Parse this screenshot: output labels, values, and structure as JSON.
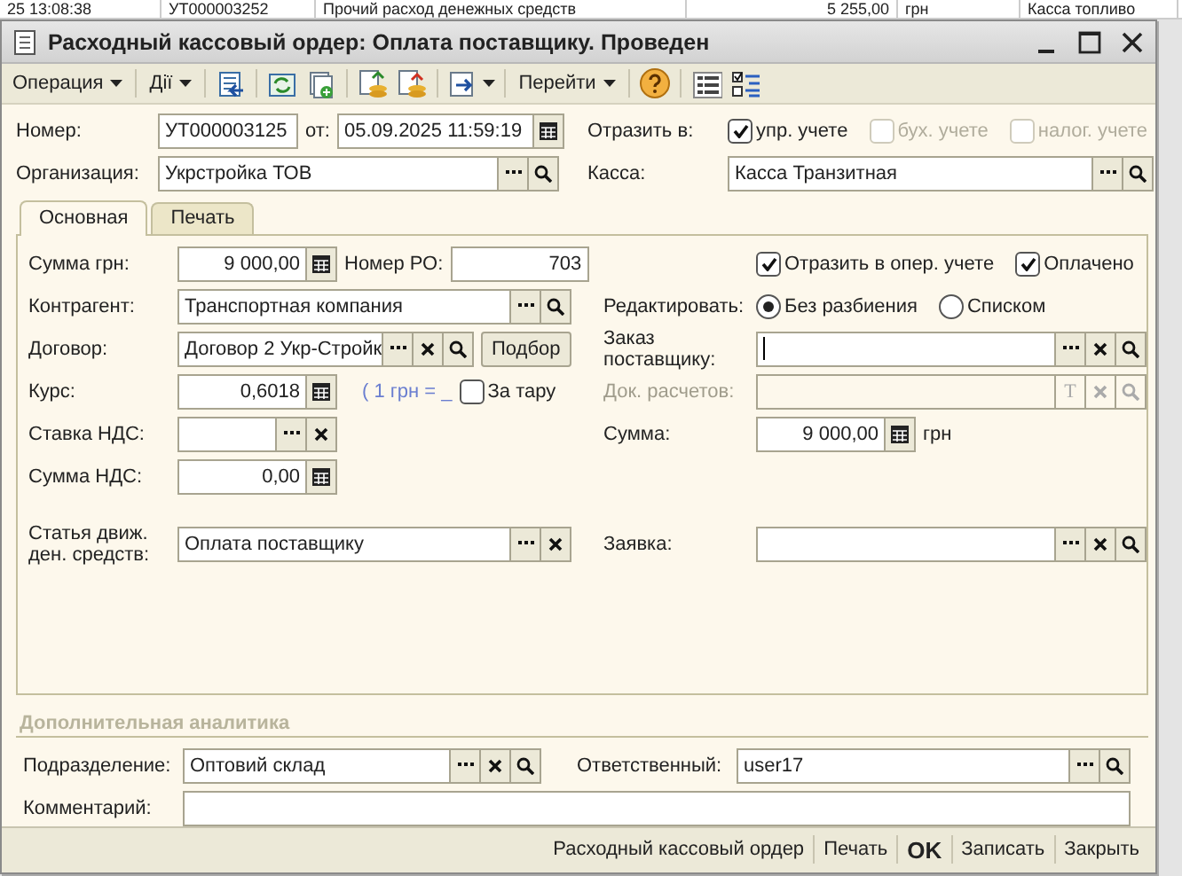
{
  "background_list": {
    "cells": [
      "25 13:08:38",
      "УТ000003252",
      "Прочий расход денежных средств",
      "5 255,00",
      "грн",
      "Касса топливо"
    ]
  },
  "window": {
    "title": "Расходный кассовый ордер: Оплата поставщику. Проведен"
  },
  "toolbar": [
    [
      {
        "kind": "menu",
        "label": "Операция"
      }
    ],
    [
      {
        "kind": "menu",
        "label": "Дії"
      }
    ],
    [
      {
        "kind": "icon"
      }
    ],
    [
      {
        "kind": "icon"
      },
      {
        "kind": "icon"
      }
    ],
    [
      {
        "kind": "icon"
      },
      {
        "kind": "icon"
      }
    ],
    [
      {
        "kind": "icon-menu"
      }
    ],
    [
      {
        "kind": "menu",
        "label": "Перейти"
      }
    ],
    [
      {
        "kind": "help"
      }
    ],
    [
      {
        "kind": "icon"
      },
      {
        "kind": "icon"
      }
    ]
  ],
  "header": {
    "rows": [
      {
        "label": "Номер:",
        "controls": [
          {
            "kind": "field",
            "value": "УТ000003125"
          },
          {
            "kind": "text",
            "label": "от:"
          },
          {
            "kind": "field",
            "value": "05.09.2025 11:59:19",
            "buttons": [
              {
                "kind": "calendar"
              }
            ]
          }
        ],
        "right": {
          "label": "Отразить в:",
          "controls": [
            {
              "kind": "check",
              "label": "упр. учете",
              "checked": true,
              "disabled": false
            },
            {
              "kind": "check",
              "label": "бух. учете",
              "checked": false,
              "disabled": true
            },
            {
              "kind": "check",
              "label": "налог. учете",
              "checked": false,
              "disabled": true
            }
          ]
        }
      },
      {
        "label": "Организация:",
        "controls": [
          {
            "kind": "field",
            "value": "Укрстройка ТОВ",
            "buttons": [
              {
                "kind": "choose"
              },
              {
                "kind": "open"
              }
            ]
          }
        ],
        "right": {
          "label": "Касса:",
          "controls": [
            {
              "kind": "field",
              "value": "Касса Транзитная",
              "buttons": [
                {
                  "kind": "choose"
                },
                {
                  "kind": "open"
                }
              ]
            }
          ]
        }
      }
    ]
  },
  "tabs": [
    {
      "label": "Основная",
      "selected": true
    },
    {
      "label": "Печать",
      "selected": false
    }
  ],
  "main": {
    "rows": [
      {
        "left": {
          "label": "Сумма грн:",
          "controls": [
            {
              "kind": "number",
              "value": "9 000,00",
              "buttons": [
                {
                  "kind": "calc"
                }
              ]
            },
            {
              "kind": "label",
              "label": "Номер РО:"
            },
            {
              "kind": "number",
              "value": "703"
            }
          ]
        },
        "right": {
          "controls": [
            {
              "kind": "check",
              "label": "Отразить в опер. учете",
              "checked": true,
              "disabled": false
            },
            {
              "kind": "check",
              "label": "Оплачено",
              "checked": true,
              "disabled": false
            }
          ]
        }
      },
      {
        "left": {
          "label": "Контрагент:",
          "controls": [
            {
              "kind": "field",
              "value": "Транспортная компания",
              "buttons": [
                {
                  "kind": "choose"
                },
                {
                  "kind": "open"
                }
              ]
            }
          ]
        },
        "right": {
          "label": "Редактировать:",
          "controls": [
            {
              "kind": "radio",
              "label": "Без разбиения",
              "selected": true
            },
            {
              "kind": "radio",
              "label": "Списком",
              "selected": false
            }
          ]
        }
      },
      {
        "left": {
          "label": "Договор:",
          "controls": [
            {
              "kind": "field",
              "value": "Договор 2 Укр-Стройк",
              "buttons": [
                {
                  "kind": "choose"
                },
                {
                  "kind": "clear"
                },
                {
                  "kind": "open"
                }
              ]
            },
            {
              "kind": "button",
              "label": "Подбор"
            }
          ]
        },
        "right": {
          "label": "Заказ поставщику:",
          "controls": [
            {
              "kind": "field",
              "cursor": true,
              "buttons": [
                {
                  "kind": "choose"
                },
                {
                  "kind": "clear"
                },
                {
                  "kind": "open"
                }
              ]
            }
          ]
        }
      },
      {
        "left": {
          "label": "Курс:",
          "controls": [
            {
              "kind": "number",
              "value": "0,6018",
              "buttons": [
                {
                  "kind": "calc"
                }
              ]
            },
            {
              "kind": "link",
              "label": "( 1 грн = _"
            },
            {
              "kind": "check",
              "label": "За тару",
              "checked": false,
              "disabled": false
            }
          ]
        },
        "right": {
          "label": "Док. расчетов:",
          "disabled": true,
          "controls": [
            {
              "kind": "field",
              "disabled": true,
              "buttons": [
                {
                  "kind": "type",
                  "label": "T"
                },
                {
                  "kind": "clear"
                },
                {
                  "kind": "open"
                }
              ]
            }
          ]
        }
      },
      {
        "left": {
          "label": "Ставка НДС:",
          "controls": [
            {
              "kind": "field",
              "buttons": [
                {
                  "kind": "choose"
                },
                {
                  "kind": "clear"
                }
              ]
            }
          ]
        },
        "right": {
          "label": "Сумма:",
          "controls": [
            {
              "kind": "number",
              "value": "9 000,00",
              "buttons": [
                {
                  "kind": "calc"
                }
              ]
            },
            {
              "kind": "text",
              "label": "грн"
            }
          ]
        }
      },
      {
        "left": {
          "label": "Сумма НДС:",
          "controls": [
            {
              "kind": "number",
              "value": "0,00",
              "buttons": [
                {
                  "kind": "calc"
                }
              ]
            }
          ]
        }
      },
      {
        "left": {
          "label": "Статья движ. ден. средств:",
          "controls": [
            {
              "kind": "field",
              "value": "Оплата поставщику",
              "buttons": [
                {
                  "kind": "choose"
                },
                {
                  "kind": "clear"
                }
              ]
            }
          ]
        },
        "right": {
          "label": "Заявка:",
          "controls": [
            {
              "kind": "field",
              "buttons": [
                {
                  "kind": "choose"
                },
                {
                  "kind": "clear"
                },
                {
                  "kind": "open"
                }
              ]
            }
          ]
        }
      }
    ]
  },
  "extra": {
    "title": "Дополнительная аналитика",
    "department": {
      "label": "Подразделение:",
      "value": "Оптовий склад",
      "buttons": [
        {
          "kind": "choose"
        },
        {
          "kind": "clear"
        },
        {
          "kind": "open"
        }
      ]
    },
    "responsible": {
      "label": "Ответственный:",
      "value": "user17",
      "buttons": [
        {
          "kind": "choose"
        },
        {
          "kind": "open"
        }
      ]
    },
    "comment": {
      "label": "Комментарий:"
    }
  },
  "footer": [
    {
      "label": "Расходный кассовый ордер",
      "default": false
    },
    {
      "label": "Печать",
      "default": false
    },
    {
      "label": "OK",
      "default": true
    },
    {
      "label": "Записать",
      "default": false
    },
    {
      "label": "Закрыть",
      "default": false
    }
  ]
}
